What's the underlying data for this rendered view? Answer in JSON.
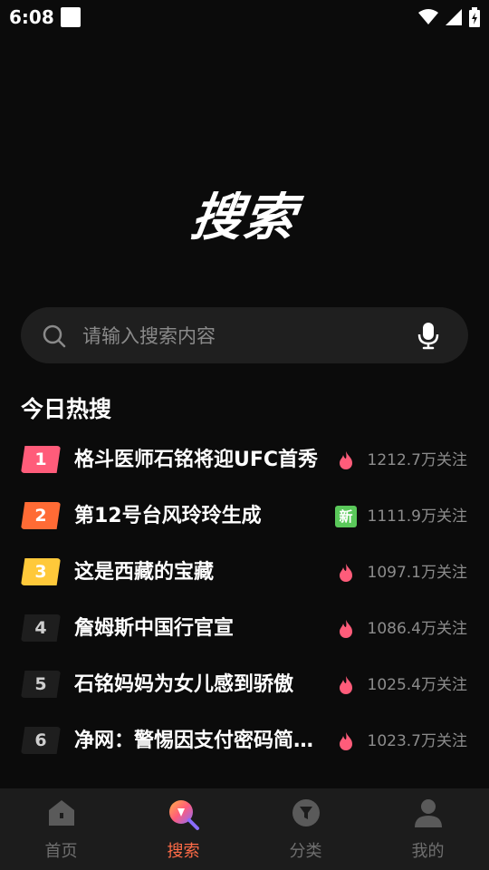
{
  "status_bar": {
    "time": "6:08"
  },
  "page": {
    "title": "搜索"
  },
  "search": {
    "placeholder": "请输入搜索内容"
  },
  "hot_section": {
    "title": "今日热搜"
  },
  "hot_list": [
    {
      "rank": "1",
      "title": "格斗医师石铭将迎UFC首秀",
      "badge": "fire-icon",
      "count": "1212.7万关注"
    },
    {
      "rank": "2",
      "title": "第12号台风玲玲生成",
      "badge": "new-badge",
      "badge_text": "新",
      "count": "1111.9万关注"
    },
    {
      "rank": "3",
      "title": "这是西藏的宝藏",
      "badge": "fire-icon",
      "count": "1097.1万关注"
    },
    {
      "rank": "4",
      "title": "詹姆斯中国行官宣",
      "badge": "fire-icon",
      "count": "1086.4万关注"
    },
    {
      "rank": "5",
      "title": "石铭妈妈为女儿感到骄傲",
      "badge": "fire-icon",
      "count": "1025.4万关注"
    },
    {
      "rank": "6",
      "title": "净网：警惕因支付密码简单被盗",
      "badge": "fire-icon",
      "count": "1023.7万关注"
    }
  ],
  "bottom_nav": {
    "items": [
      {
        "label": "首页",
        "icon": "home-icon"
      },
      {
        "label": "搜索",
        "icon": "search-icon",
        "active": true
      },
      {
        "label": "分类",
        "icon": "category-icon"
      },
      {
        "label": "我的",
        "icon": "profile-icon"
      }
    ]
  },
  "colors": {
    "background": "#0b0b0b",
    "rank1": "#ff5c7a",
    "rank2": "#ff6b35",
    "rank3": "#ffc93a",
    "fire": "#ff5c7a",
    "new_badge": "#5ac85a",
    "active_nav": "#ff6b47"
  }
}
